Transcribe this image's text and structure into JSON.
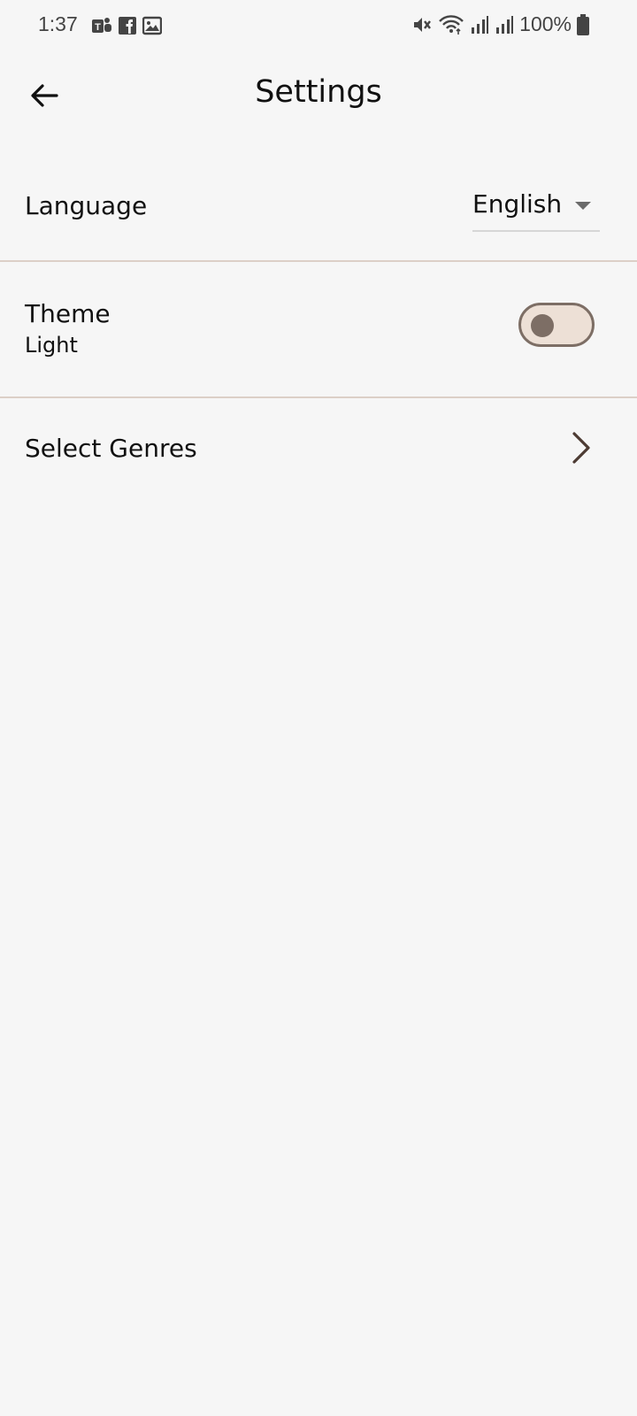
{
  "status_bar": {
    "time": "1:37",
    "battery": "100%",
    "icons": [
      "teams-icon",
      "facebook-icon",
      "gallery-icon",
      "mute-icon",
      "wifi-icon",
      "signal-icon",
      "signal-icon",
      "battery-icon"
    ]
  },
  "header": {
    "title": "Settings",
    "back_icon": "arrow-back-icon"
  },
  "settings": {
    "language": {
      "label": "Language",
      "value": "English"
    },
    "theme": {
      "label": "Theme",
      "value": "Light",
      "toggle_on": false
    },
    "genres": {
      "label": "Select Genres",
      "icon": "chevron-right-icon"
    }
  },
  "colors": {
    "background": "#f6f6f6",
    "divider": "#dccfc7",
    "toggle_border": "#7d6e65",
    "toggle_fill": "#ede0d6",
    "chevron": "#4d3b33"
  }
}
